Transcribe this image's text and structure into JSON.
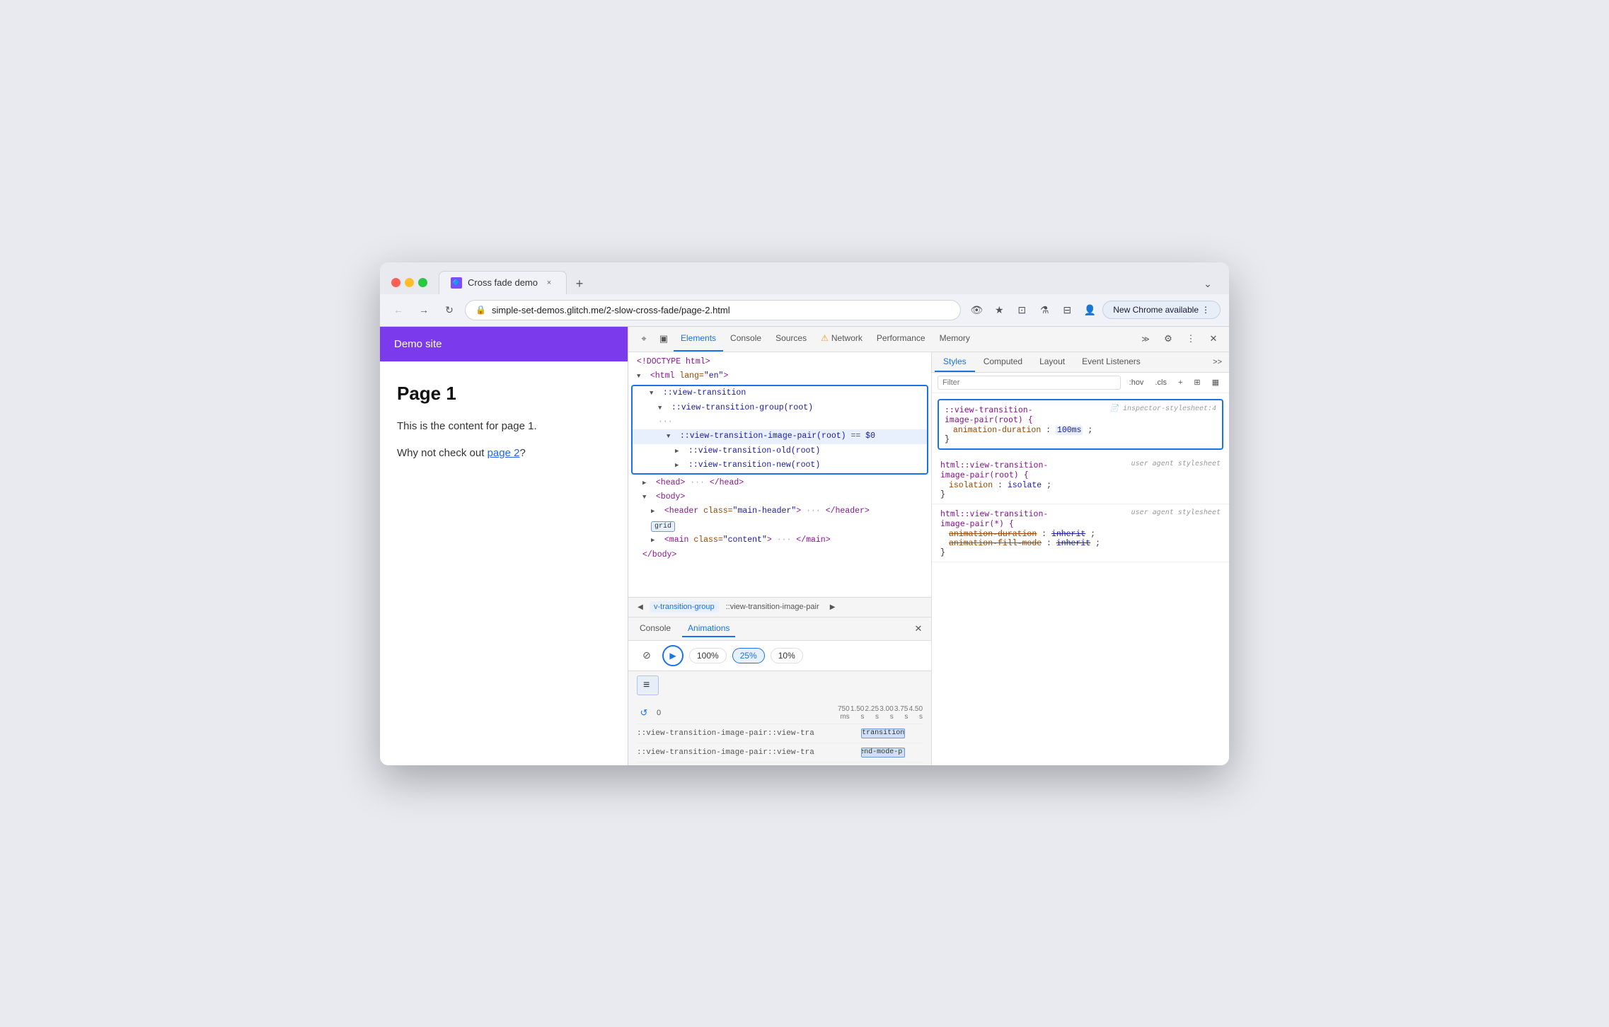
{
  "browser": {
    "traffic_lights": [
      "red",
      "yellow",
      "green"
    ],
    "tab": {
      "favicon": "🔷",
      "title": "Cross fade demo",
      "close": "×"
    },
    "new_tab_icon": "+",
    "tab_list_icon": "⌄",
    "nav": {
      "back": "←",
      "forward": "→",
      "refresh": "↻",
      "lock_icon": "🔒",
      "url": "simple-set-demos.glitch.me/2-slow-cross-fade/page-2.html",
      "eye_off": "👁",
      "bookmark": "★",
      "extensions": "⊡",
      "lab": "⚗",
      "split": "⊟",
      "profile": "👤",
      "new_chrome_available": "New Chrome available",
      "menu": "⋮"
    }
  },
  "devtools": {
    "tabs": [
      "Elements",
      "Console",
      "Sources",
      "Network",
      "Performance",
      "Memory"
    ],
    "active_tab": "Elements",
    "warning_tab": "Network",
    "more_tabs": ">>",
    "settings_icon": "⚙",
    "more_options_icon": "⋮",
    "close_icon": "×",
    "cursor_icon": "⌖",
    "layout_icon": "▣",
    "elements": {
      "doctype": "<!DOCTYPE html>",
      "html_open": "<html lang=\"en\">",
      "view_transition": "::view-transition",
      "view_transition_group": "::view-transition-group(root)",
      "ellipsis": "...",
      "view_transition_image_pair": "::view-transition-image-pair(root) == $0",
      "view_transition_old": "::view-transition-old(root)",
      "view_transition_new": "::view-transition-new(root)",
      "head_open": "<head> ··· </head>",
      "body_open": "<body>",
      "header_el": "<header class=\"main-header\"> ··· </header>",
      "grid_badge": "grid",
      "main_el": "<main class=\"content\"> ··· </main>",
      "body_close": "</body>"
    },
    "breadcrumb": {
      "items": [
        "v-transition-group",
        "::view-transition-image-pair"
      ],
      "left_arrow": "◀",
      "right_arrow": "▶"
    },
    "styles": {
      "tabs": [
        "Styles",
        "Computed",
        "Layout",
        "Event Listeners"
      ],
      "active_tab": "Styles",
      "more": ">>",
      "filter_placeholder": "Filter",
      "hov_btn": ":hov",
      "cls_btn": ".cls",
      "add_btn": "+",
      "new_style_btn": "⊞",
      "color_picker_btn": "▦",
      "highlighted_rule": {
        "selector": "::view-transition-image-pair(root) {",
        "source": "inspector-stylesheet:4",
        "source_icon": "📄",
        "property": "animation-duration",
        "value": "100ms",
        "close": "}"
      },
      "ua_rule_1": {
        "selector": "html::view-transition-image-pair(root) {",
        "source": "user agent stylesheet",
        "property": "isolation",
        "value": "isolate",
        "close": "}"
      },
      "ua_rule_2": {
        "selector": "html::view-transition-image-pair(*) {",
        "source": "user agent stylesheet",
        "property1": "animation-duration",
        "value1": "inherit",
        "property2": "animation-fill-mode",
        "value2": "inherit",
        "close": "}"
      }
    },
    "bottom_panel": {
      "tabs": [
        "Console",
        "Animations"
      ],
      "active_tab": "Animations",
      "close_icon": "×",
      "pause_icon": "⊘",
      "play_icon": "▶",
      "speed_options": [
        "100%",
        "25%",
        "10%"
      ],
      "group_lines": "≡",
      "timeline": {
        "replay_icon": "↺",
        "markers": [
          "0",
          "750 ms",
          "1.50 s",
          "2.25 s",
          "3.00 s",
          "3.75 s",
          "4.50 s"
        ],
        "rows": [
          {
            "label": "::view-transition-image-pair::view-tra",
            "animation": "-ua-view-transition-fade-out"
          },
          {
            "label": "::view-transition-image-pair::view-tra",
            "animation": "-ua-mix-blend-mode-plus-lighter"
          }
        ]
      }
    }
  },
  "demo_site": {
    "header": "Demo site",
    "page_title": "Page 1",
    "content_p1": "This is the content for page 1.",
    "content_p2_prefix": "Why not check out ",
    "content_link": "page 2",
    "content_p2_suffix": "?"
  }
}
